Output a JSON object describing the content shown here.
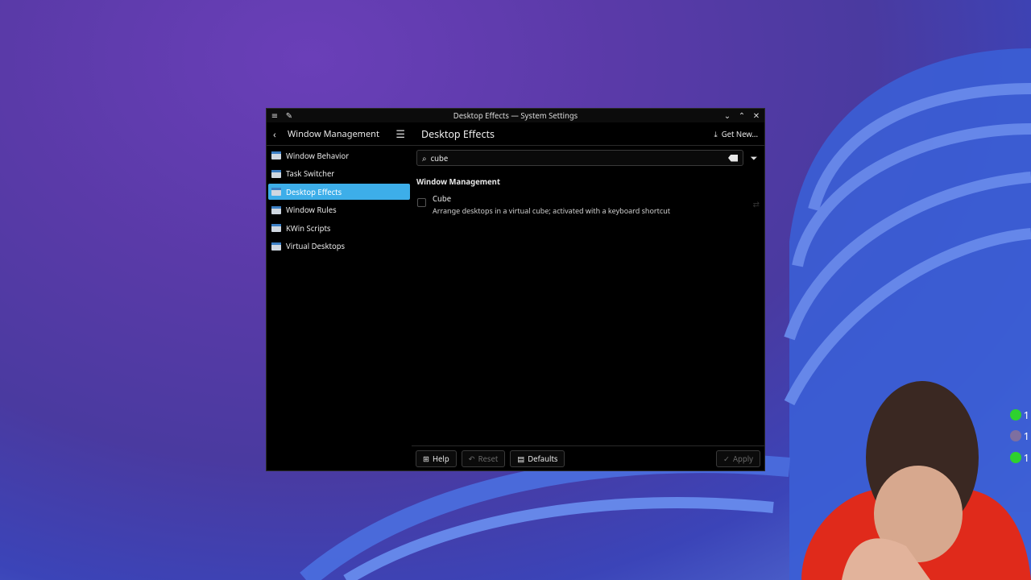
{
  "window": {
    "title": "Desktop Effects — System Settings"
  },
  "sidebar": {
    "header": "Window Management",
    "items": [
      {
        "label": "Window Behavior"
      },
      {
        "label": "Task Switcher"
      },
      {
        "label": "Desktop Effects"
      },
      {
        "label": "Window Rules"
      },
      {
        "label": "KWin Scripts"
      },
      {
        "label": "Virtual Desktops"
      }
    ]
  },
  "main": {
    "title": "Desktop Effects",
    "get_new": "Get New...",
    "search_value": "cube",
    "section": "Window Management",
    "effect": {
      "name": "Cube",
      "description": "Arrange desktops in a virtual cube; activated with a keyboard shortcut"
    }
  },
  "footer": {
    "help": "Help",
    "reset": "Reset",
    "defaults": "Defaults",
    "apply": "Apply"
  },
  "hud": [
    "1",
    "1",
    "1"
  ],
  "colors": {
    "accent": "#3daee9",
    "window_bg": "#000000"
  }
}
